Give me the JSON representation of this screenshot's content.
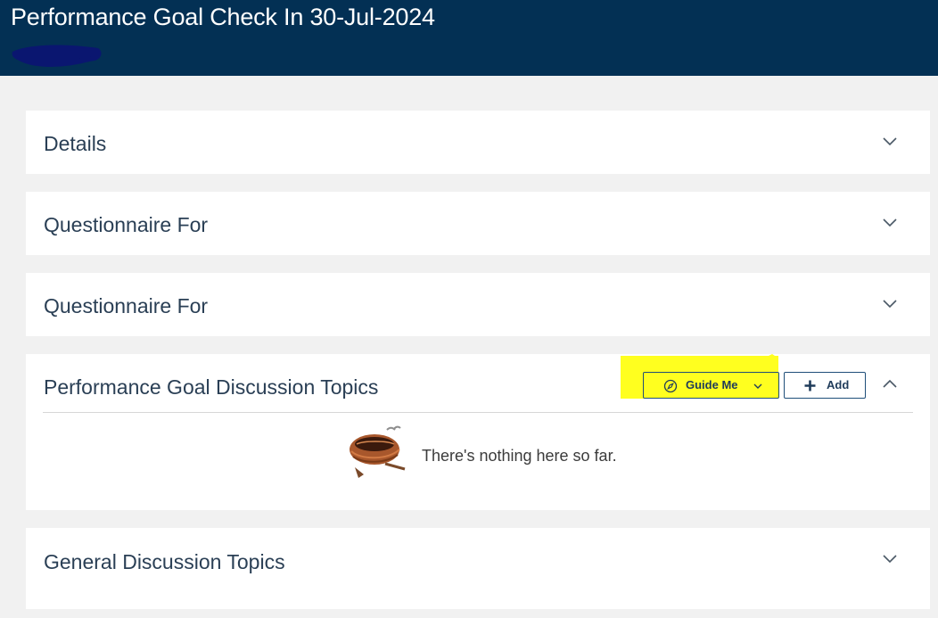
{
  "header": {
    "title": "Performance Goal Check In 30-Jul-2024"
  },
  "sections": [
    {
      "title": "Details",
      "expanded": false
    },
    {
      "title": "Questionnaire For",
      "expanded": false
    },
    {
      "title": "Questionnaire For",
      "expanded": false
    },
    {
      "title": "Performance Goal Discussion Topics",
      "expanded": true
    },
    {
      "title": "General Discussion Topics",
      "expanded": false
    }
  ],
  "topics": {
    "guide_me_label": "Guide Me",
    "add_label": "Add",
    "empty_message": "There's nothing here so far."
  },
  "icons": {
    "collapsed": "chevron-down-icon",
    "expanded": "chevron-up-icon",
    "guide": "compass-icon",
    "add": "plus-icon",
    "empty": "empty-nest-icon"
  },
  "colors": {
    "header_bg": "#033054",
    "page_bg": "#f1f1f1",
    "highlight": "#ffff1f",
    "button_border": "#1f4e79"
  }
}
